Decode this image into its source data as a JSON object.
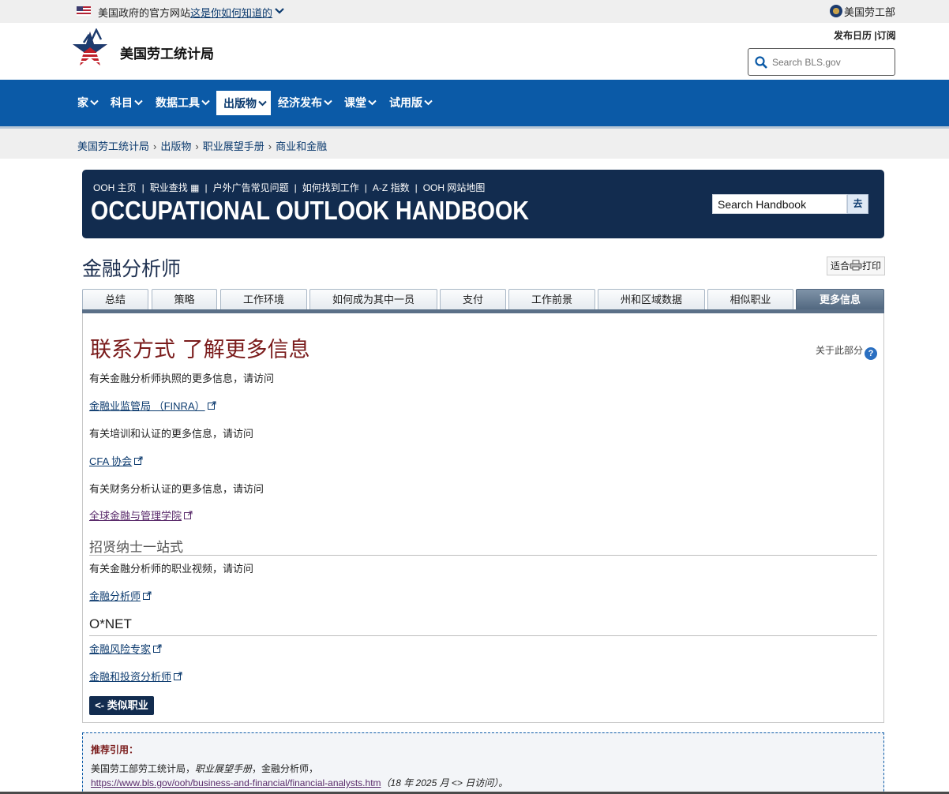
{
  "gov_banner": {
    "text": "美国政府的官方网站",
    "link": "这是你如何知道的",
    "dept": "美国劳工部"
  },
  "header": {
    "logo_text": "美国劳工统计局",
    "util_links": "发布日历 |订阅",
    "search_placeholder": "Search BLS.gov"
  },
  "nav": {
    "items": [
      {
        "label": "家"
      },
      {
        "label": "科目"
      },
      {
        "label": "数据工具"
      },
      {
        "label": "出版物"
      },
      {
        "label": "经济发布"
      },
      {
        "label": "课堂"
      },
      {
        "label": "试用版"
      }
    ],
    "active_index": 3
  },
  "breadcrumb": [
    "美国劳工统计局",
    "出版物",
    "职业展望手册",
    "商业和金融"
  ],
  "ooh": {
    "links": [
      "OOH 主页",
      "职业查找",
      "户外广告常见问题",
      "如何找到工作",
      "A-Z 指数",
      "OOH 网站地图"
    ],
    "title": "OCCUPATIONAL OUTLOOK HANDBOOK",
    "search_value": "Search Handbook",
    "go_label": "去"
  },
  "page": {
    "title": "金融分析师",
    "print_label_a": "适合",
    "print_label_b": "打印"
  },
  "tabs": [
    {
      "label": "总结"
    },
    {
      "label": "策略"
    },
    {
      "label": "工作环境"
    },
    {
      "label": "如何成为其中一员"
    },
    {
      "label": "支付"
    },
    {
      "label": "工作前景"
    },
    {
      "label": "州和区域数据"
    },
    {
      "label": "相似职业"
    },
    {
      "label": "更多信息"
    }
  ],
  "content": {
    "heading": "联系方式 了解更多信息",
    "about_section": "关于此部分",
    "about_icon": "?",
    "p1": "有关金融分析师执照的更多信息，请访问",
    "link1": "金融业监管局 （FINRA）",
    "p2": "有关培训和认证的更多信息，请访问",
    "link2": "CFA 协会",
    "p3": "有关财务分析认证的更多信息，请访问",
    "link3": "全球金融与管理学院",
    "h3_1": "招贤纳士一站式",
    "p4": "有关金融分析师的职业视频，请访问",
    "link4": "金融分析师",
    "h3_2": "O*NET",
    "link5": "金融风险专家",
    "link6": "金融和投资分析师",
    "back_button": "<- 类似职业"
  },
  "citation": {
    "heading": "推荐引用：",
    "line1_a": "美国劳工部劳工统计局，",
    "line1_b": "职业展望手册",
    "line1_c": "，金融分析师，",
    "url": "https://www.bls.gov/ooh/business-and-financial/financial-analysts.htm",
    "accessed": "（18 年 2025 月 <> 日访问）。"
  },
  "colors": {
    "nav_blue": "#0b5aa7",
    "ooh_navy": "#122c4f",
    "heading_red": "#7a1b1b"
  }
}
